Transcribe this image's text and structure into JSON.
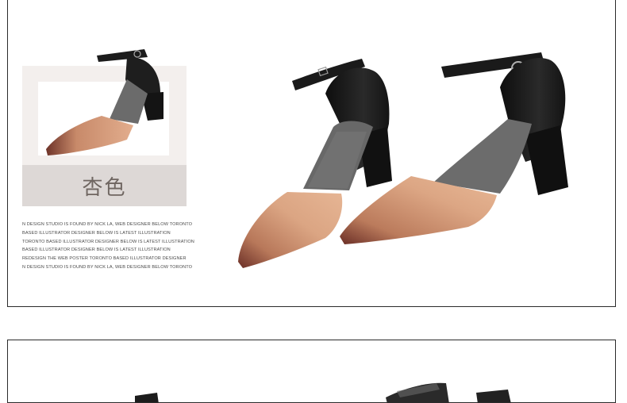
{
  "color_option": {
    "label": "杏色"
  },
  "description_lines": [
    "N DESIGN STUDIO IS FOUND BY NICK LA, WEB DESIGNER BELOW TORONTO",
    "BASED ILLUSTRATOR DESIGNER BELOW IS LATEST ILLUSTRATION",
    "TORONTO BASED ILLUSTRATOR DESIGNER BELOW IS LATEST ILLUSTRATION",
    "BASED ILLUSTRATOR DESIGNER BELOW IS LATEST ILLUSTRATION",
    "REDESIGN THE WEB POSTER TORONTO BASED ILLUSTRATOR DESIGNER",
    "N DESIGN STUDIO IS FOUND BY NICK LA, WEB DESIGNER BELOW TORONTO"
  ],
  "colors": {
    "apricot": "#d9a07e",
    "apricot_dark": "#7a3b30",
    "leather_black": "#1c1c1c",
    "insole_gray": "#6b6b6b",
    "panel_border": "#2b2b2b"
  }
}
